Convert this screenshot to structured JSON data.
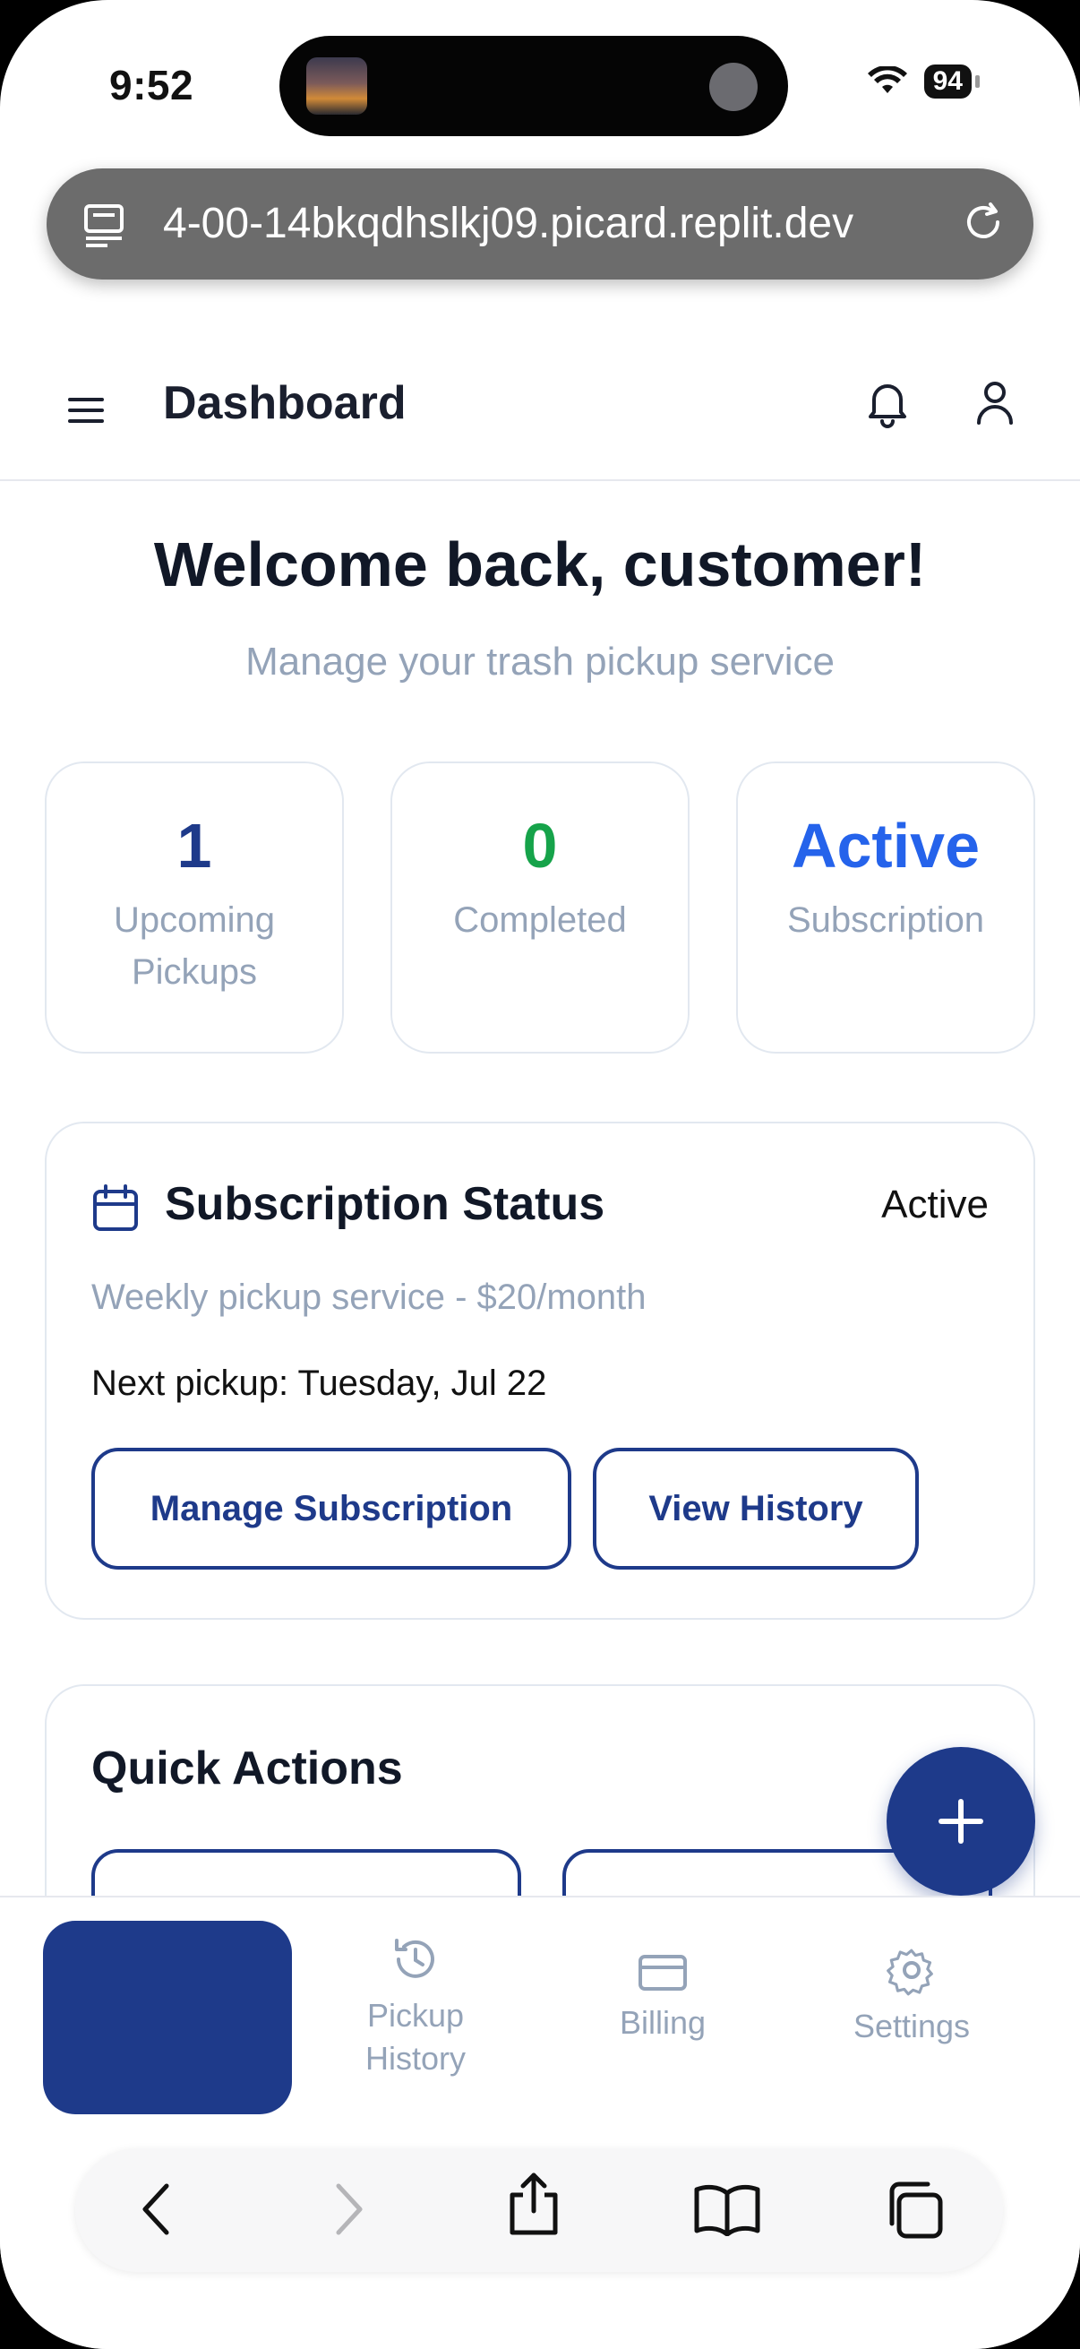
{
  "status_bar": {
    "time": "9:52",
    "battery": "94"
  },
  "browser": {
    "url": "4-00-14bkqdhslkj09.picard.replit.dev"
  },
  "header": {
    "title": "Dashboard"
  },
  "welcome": {
    "heading": "Welcome back, customer!",
    "subtitle": "Manage your trash pickup service"
  },
  "stats": [
    {
      "value": "1",
      "label": "Upcoming Pickups",
      "color": "#1e3a8a"
    },
    {
      "value": "0",
      "label": "Completed",
      "color": "#16a34a"
    },
    {
      "value": "Active",
      "label": "Subscription",
      "color": "#2563eb"
    }
  ],
  "subscription": {
    "title": "Subscription Status",
    "status": "Active",
    "plan": "Weekly pickup service - $20/month",
    "next_pickup": "Next pickup: Tuesday, Jul 22",
    "manage_label": "Manage Subscription",
    "history_label": "View History"
  },
  "quick_actions": {
    "title": "Quick Actions"
  },
  "bottom_nav": {
    "items": [
      {
        "label": "",
        "icon": "home"
      },
      {
        "label": "Pickup History",
        "icon": "history-icon"
      },
      {
        "label": "Billing",
        "icon": "credit-card-icon"
      },
      {
        "label": "Settings",
        "icon": "gear-icon"
      }
    ]
  },
  "colors": {
    "primary": "#1e3a8a",
    "success": "#16a34a",
    "accent": "#2563eb",
    "muted": "#94a3b8"
  }
}
